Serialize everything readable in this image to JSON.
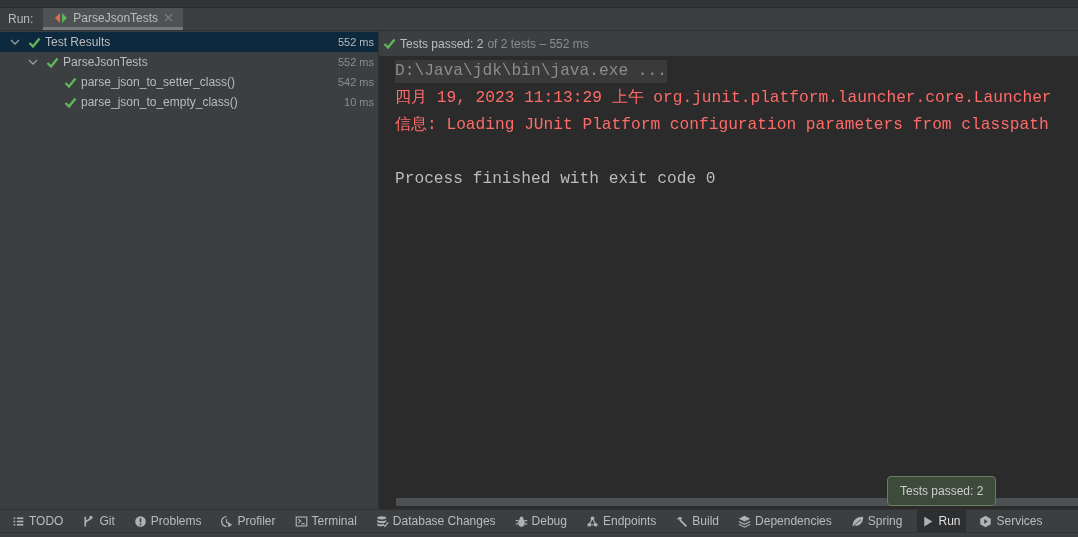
{
  "run_label": "Run:",
  "tabs": [
    {
      "label": "ParseJsonTests",
      "selected": true
    }
  ],
  "tree": [
    {
      "label": "Test Results",
      "time": "552 ms",
      "expanded": true,
      "selected": true,
      "children": [
        {
          "label": "ParseJsonTests",
          "time": "552 ms",
          "expanded": true,
          "selected": false,
          "children": [
            {
              "label": "parse_json_to_setter_class()",
              "time": "542 ms",
              "selected": false
            },
            {
              "label": "parse_json_to_empty_class()",
              "time": "10 ms",
              "selected": false
            }
          ]
        }
      ]
    }
  ],
  "summary": {
    "passed": "Tests passed: 2",
    "detail": "of 2 tests – 552 ms"
  },
  "console": [
    {
      "kind": "command",
      "text": "D:\\Java\\jdk\\bin\\java.exe ..."
    },
    {
      "kind": "error",
      "text": "四月 19, 2023 11:13:29 上午 org.junit.platform.launcher.core.Launcher"
    },
    {
      "kind": "error",
      "text": "信息: Loading JUnit Platform configuration parameters from classpath"
    },
    {
      "kind": "blank"
    },
    {
      "kind": "normal",
      "text": "Process finished with exit code 0"
    }
  ],
  "toolbar": [
    {
      "label": "TODO",
      "selected": false
    },
    {
      "label": "Git",
      "selected": false
    },
    {
      "label": "Problems",
      "selected": false
    },
    {
      "label": "Profiler",
      "selected": false
    },
    {
      "label": "Terminal",
      "selected": false
    },
    {
      "label": "Database Changes",
      "selected": false
    },
    {
      "label": "Debug",
      "selected": false
    },
    {
      "label": "Endpoints",
      "selected": false
    },
    {
      "label": "Build",
      "selected": false
    },
    {
      "label": "Dependencies",
      "selected": false
    },
    {
      "label": "Spring",
      "selected": false
    },
    {
      "label": "Run",
      "selected": true
    },
    {
      "label": "Services",
      "selected": false
    }
  ],
  "tooltip": "Tests passed: 2"
}
